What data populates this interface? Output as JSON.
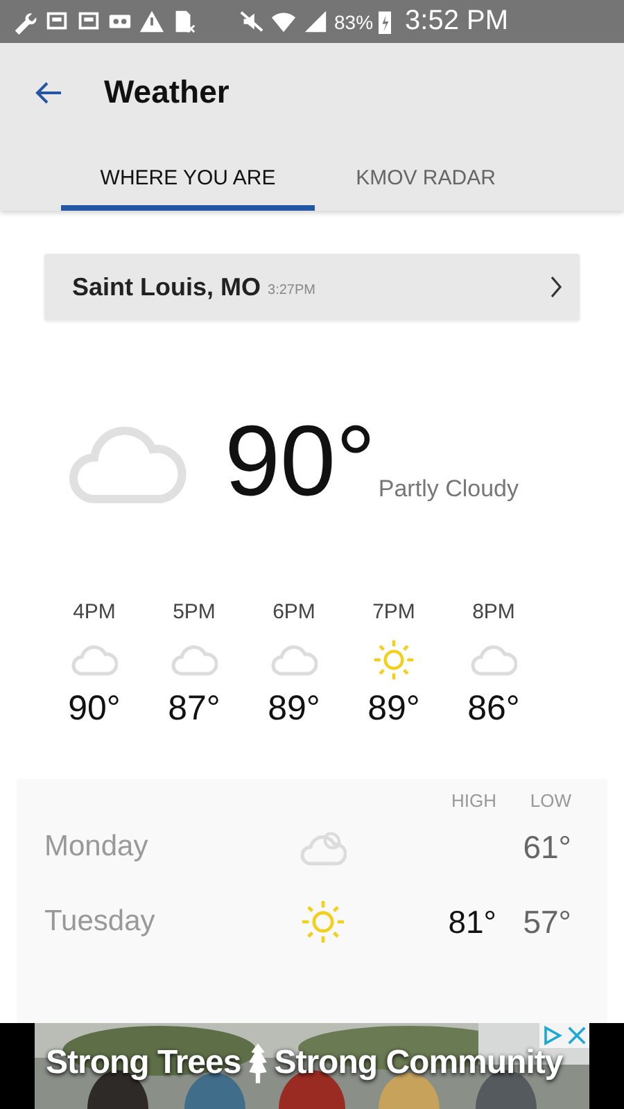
{
  "status_bar": {
    "battery": "83%",
    "time": "3:52 PM"
  },
  "app_bar": {
    "title": "Weather"
  },
  "tabs": [
    {
      "label": "WHERE YOU ARE",
      "selected": true
    },
    {
      "label": "KMOV RADAR",
      "selected": false
    }
  ],
  "location": {
    "name": "Saint Louis, MO",
    "time": "3:27PM"
  },
  "current": {
    "kind": "cloud",
    "temperature": "90°",
    "condition": "Partly Cloudy"
  },
  "hourly": [
    {
      "time": "4PM",
      "kind": "cloud",
      "temperature": "90°"
    },
    {
      "time": "5PM",
      "kind": "cloud",
      "temperature": "87°"
    },
    {
      "time": "6PM",
      "kind": "cloud",
      "temperature": "89°"
    },
    {
      "time": "7PM",
      "kind": "sun",
      "temperature": "89°"
    },
    {
      "time": "8PM",
      "kind": "cloud",
      "temperature": "86°"
    }
  ],
  "daily": {
    "columns": [
      "HIGH",
      "LOW"
    ],
    "rows": [
      {
        "day": "Monday",
        "kind": "night",
        "low": "61°"
      },
      {
        "day": "Tuesday",
        "kind": "sun",
        "high": "81°",
        "low": "57°"
      }
    ]
  },
  "ad": {
    "headline": "Strong Trees",
    "headline_2": "Strong Community"
  }
}
